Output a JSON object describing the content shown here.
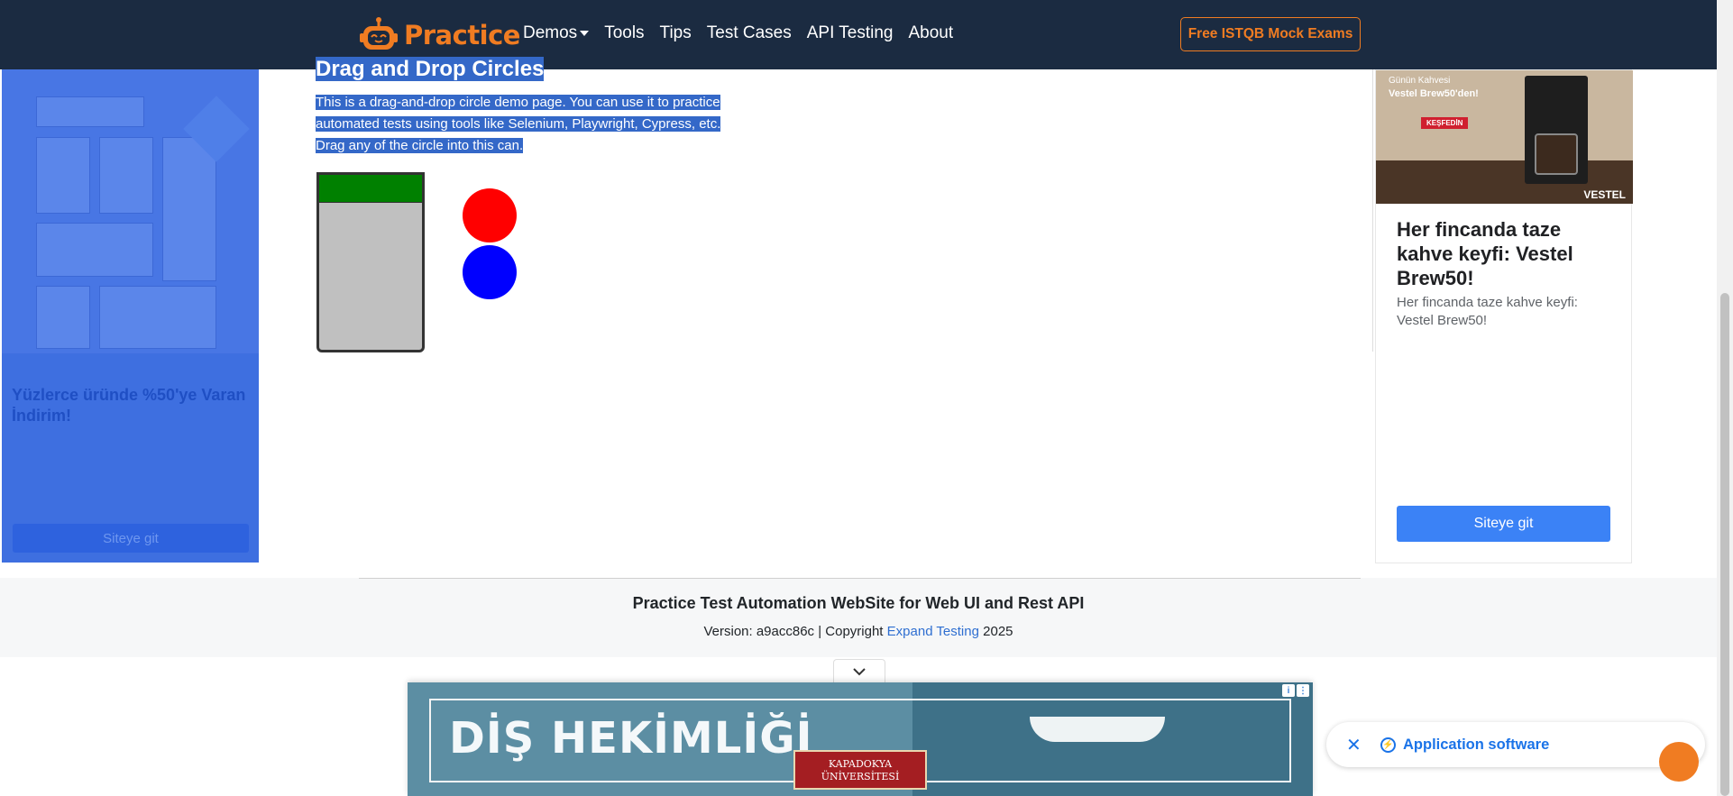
{
  "navbar": {
    "brand": "Practice",
    "links": [
      "Demos",
      "Tools",
      "Tips",
      "Test Cases",
      "API Testing",
      "About"
    ],
    "cta": "Free ISTQB Mock Exams"
  },
  "main": {
    "title": "Drag and Drop Circles",
    "intro": "This is a drag-and-drop circle demo page. You can use it to practice automated tests using tools like Selenium, Playwright, Cypress, etc. Drag any of the circle into this can.",
    "circles": [
      {
        "color": "#ff0000"
      },
      {
        "color": "#0000ff"
      }
    ]
  },
  "ad_left": {
    "headline": "Yüzlerce üründe %50'ye Varan İndirim!",
    "button": "Siteye git"
  },
  "ad_right": {
    "image_small": "Günün Kahvesi",
    "image_bold": "Vestel Brew50'den!",
    "image_cta": "KEŞFEDİN",
    "image_brand": "VESTEL",
    "headline": "Her fincanda taze kahve keyfi: Vestel Brew50!",
    "description": "Her fincanda taze kahve keyfi: Vestel Brew50!",
    "button": "Siteye git"
  },
  "footer": {
    "title": "Practice Test Automation WebSite for Web UI and Rest API",
    "version_prefix": "Version: a9acc86c | Copyright",
    "link": "Expand Testing",
    "year": "2025"
  },
  "banner": {
    "text": "DİŞ HEKİMLİĞİ",
    "logo_line1": "KAPADOKYA",
    "logo_line2": "ÜNİVERSİTESİ"
  },
  "chip": {
    "label": "Application software"
  },
  "colors": {
    "navbar_bg": "#1b2b41",
    "brand_orange": "#f07c22",
    "selection": "#3468c8",
    "can_lid": "#008000",
    "can_body": "#c0c0c0"
  }
}
